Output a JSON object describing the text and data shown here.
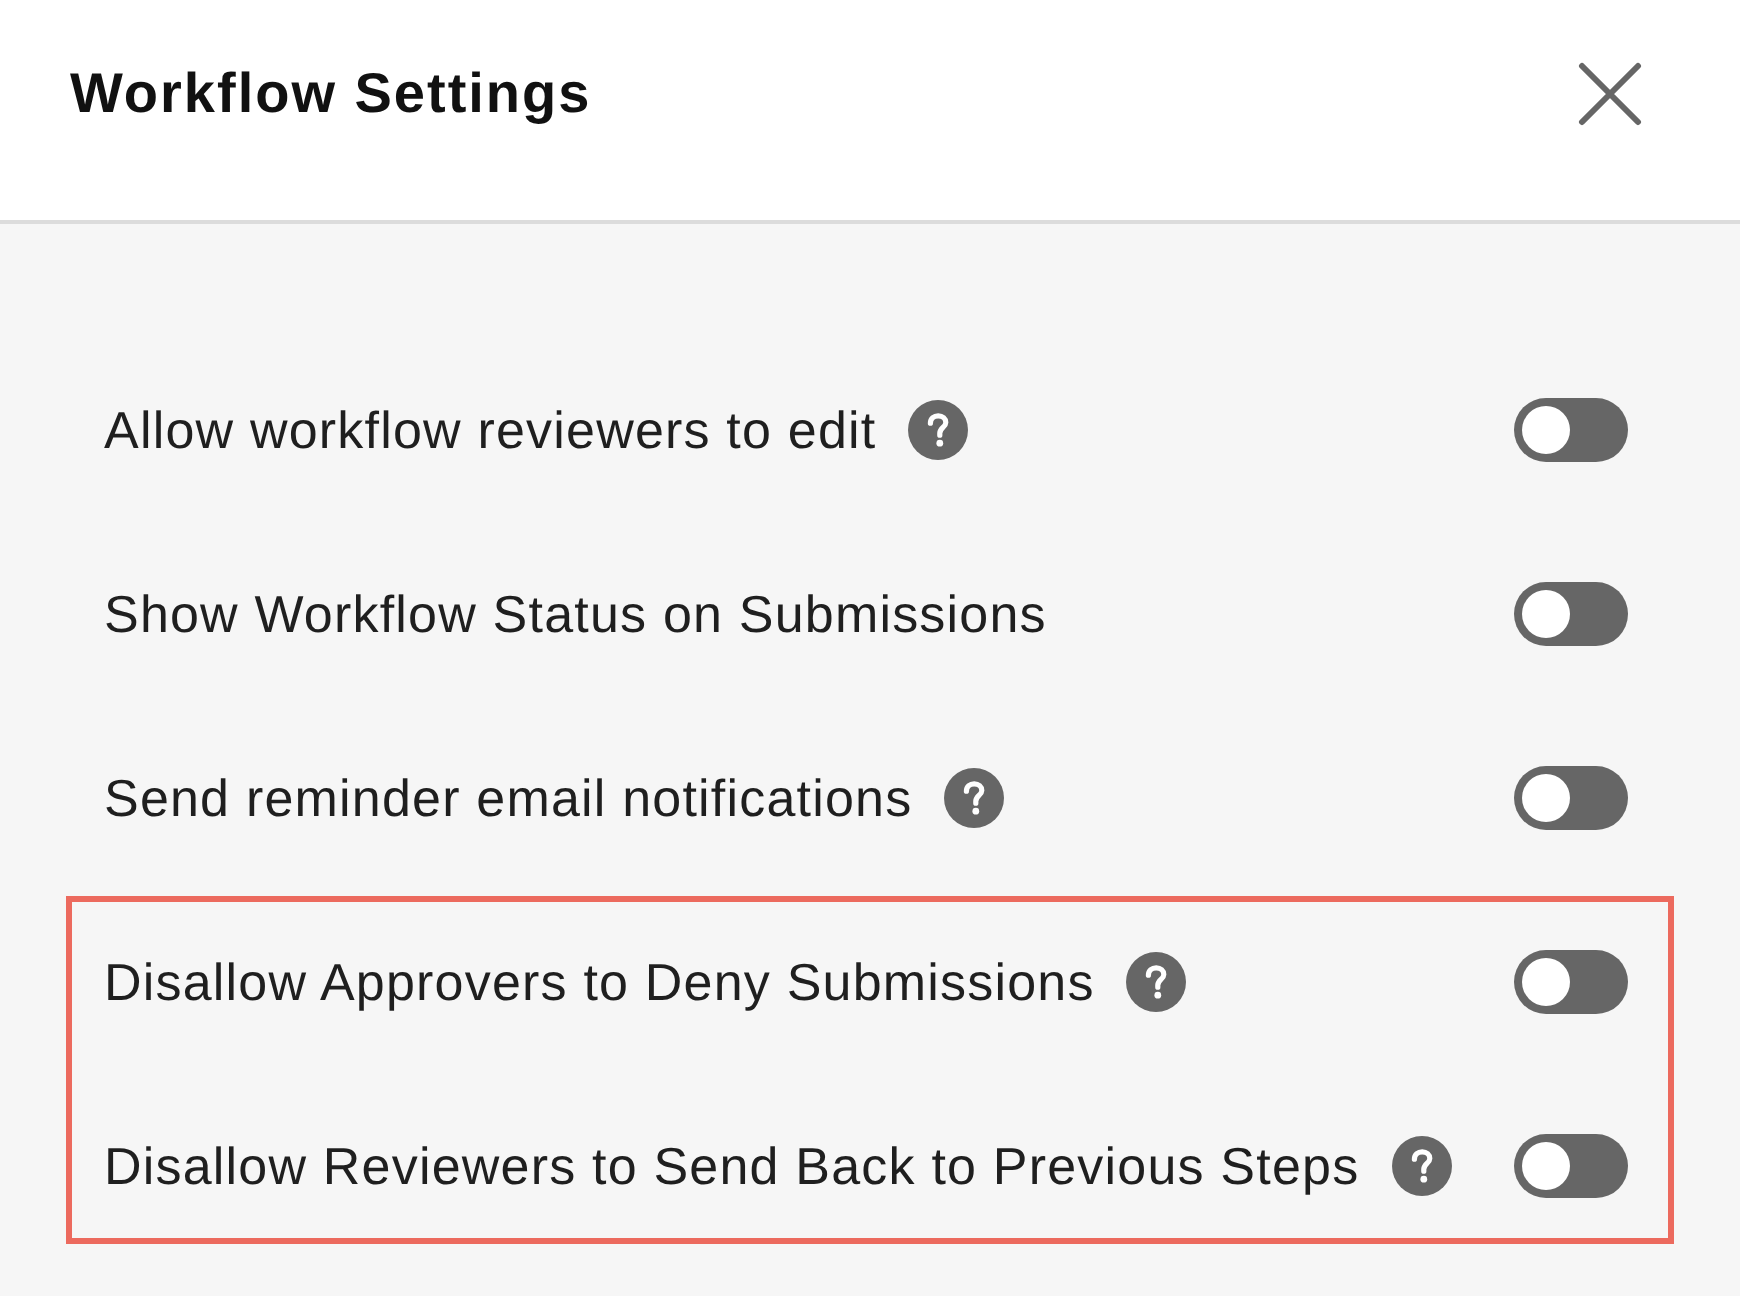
{
  "dialog": {
    "title": "Workflow Settings"
  },
  "groups": [
    {
      "highlighted": false,
      "settings": [
        {
          "label": "Allow workflow reviewers to edit",
          "help": true,
          "on": false
        },
        {
          "label": "Show Workflow Status on Submissions",
          "help": false,
          "on": false
        },
        {
          "label": "Send reminder email notifications",
          "help": true,
          "on": false
        }
      ]
    },
    {
      "highlighted": true,
      "settings": [
        {
          "label": "Disallow Approvers to Deny Submissions",
          "help": true,
          "on": false
        },
        {
          "label": "Disallow Reviewers to Send Back to Previous Steps",
          "help": true,
          "on": false
        }
      ]
    }
  ]
}
